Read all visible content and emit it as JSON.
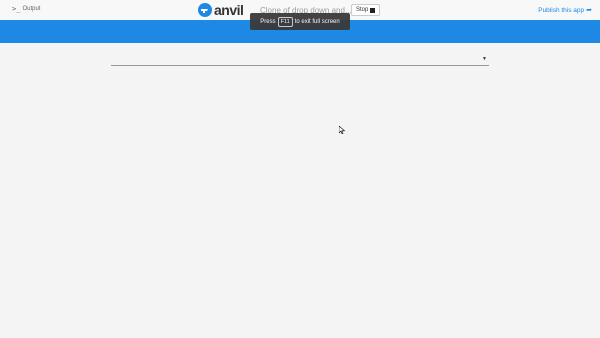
{
  "topbar": {
    "output_icon": "terminal-icon",
    "output_glyph": ">_",
    "output_label": "Output",
    "logo_text": "anvil",
    "app_title": "Clone of drop down and...",
    "stop_label": "Stop",
    "publish_label": "Publish this app",
    "publish_icon": "share-arrow-icon"
  },
  "fullscreen_toast": {
    "prefix": "Press",
    "key": "F11",
    "suffix": "to exit full screen"
  },
  "dropdown": {
    "selected": "",
    "caret_glyph": "▼"
  },
  "colors": {
    "accent": "#1e88e5",
    "page_background": "#f4f4f4"
  }
}
